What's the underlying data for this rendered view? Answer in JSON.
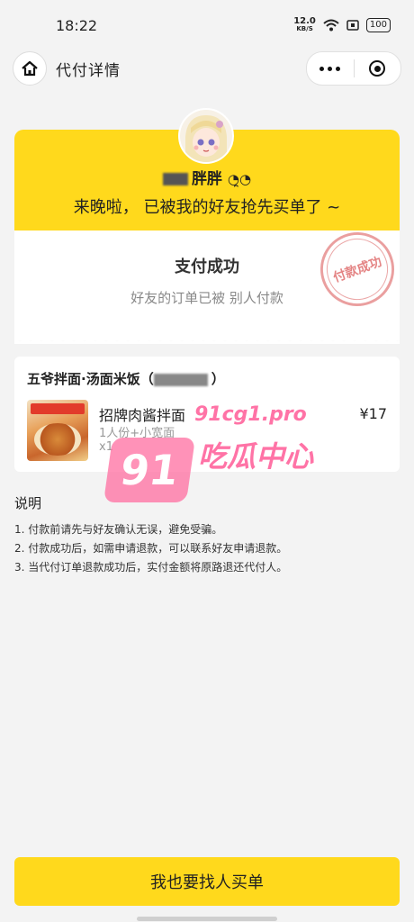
{
  "status": {
    "time": "18:22",
    "speed_value": "12.0",
    "speed_unit": "KB/S",
    "battery": "100"
  },
  "nav": {
    "title": "代付详情"
  },
  "card": {
    "friend_name_suffix": "胖胖",
    "late_message": "来晚啦， 已被我的好友抢先买单了 ~",
    "pay_title": "支付成功",
    "pay_subtitle": "好友的订单已被 别人付款",
    "stamp_text": "付款成功"
  },
  "order": {
    "shop": "五爷拌面·汤面米饭（",
    "items": [
      {
        "name": "招牌肉酱拌面",
        "spec": "1人份+小宽面",
        "qty": "x1",
        "price": "¥17"
      }
    ]
  },
  "watermark": {
    "badge": "91",
    "url": "91cg1.pro",
    "cn": "吃瓜中心"
  },
  "description": {
    "title": "说明",
    "items": [
      "1. 付款前请先与好友确认无误，避免受骗。",
      "2. 付款成功后，如需申请退款，可以联系好友申请退款。",
      "3. 当代付订单退款成功后，实付金额将原路退还代付人。"
    ]
  },
  "footer": {
    "button_label": "我也要找人买单"
  }
}
